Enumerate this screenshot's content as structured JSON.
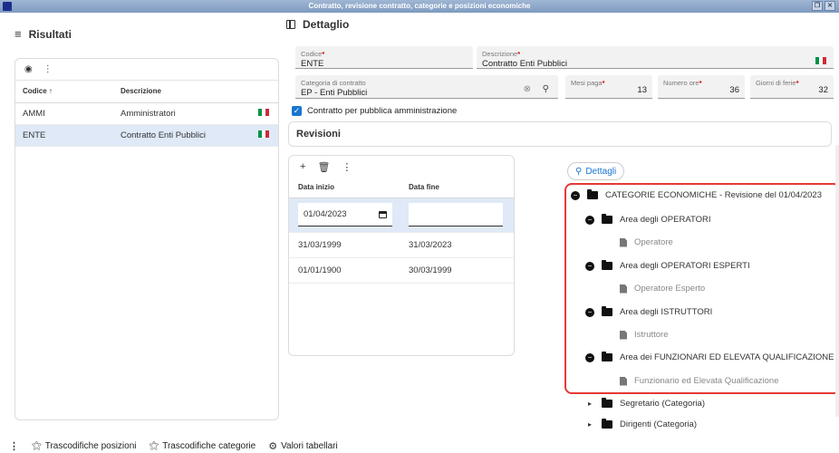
{
  "window": {
    "title": "Contratto, revisione contratto, categorie e posizioni economiche"
  },
  "left": {
    "title": "Risultati",
    "columns": [
      "Codice",
      "Descrizione"
    ],
    "sort_indicator": "↑",
    "rows": [
      {
        "codice": "AMMI",
        "descrizione": "Amministratori"
      },
      {
        "codice": "ENTE",
        "descrizione": "Contratto Enti Pubblici"
      }
    ]
  },
  "detail": {
    "title": "Dettaglio",
    "codice": {
      "label": "Codice",
      "value": "ENTE"
    },
    "descrizione": {
      "label": "Descrizione",
      "value": "Contratto Enti Pubblici"
    },
    "categoria": {
      "label": "Categoria di contratto",
      "value": "EP - Enti Pubblici"
    },
    "mesi_paga": {
      "label": "Mesi paga",
      "value": "13"
    },
    "numero_ore": {
      "label": "Numero ore",
      "value": "36"
    },
    "giorni_ferie": {
      "label": "Giorni di ferie",
      "value": "32"
    },
    "checkbox_label": "Contratto per pubblica amministrazione",
    "required_mark": "*"
  },
  "revisioni": {
    "title": "Revisioni",
    "columns": [
      "Data inizio",
      "Data fine"
    ],
    "editing_row": {
      "inizio": "01/04/2023",
      "fine": ""
    },
    "rows": [
      {
        "inizio": "31/03/1999",
        "fine": "31/03/2023"
      },
      {
        "inizio": "01/01/1900",
        "fine": "30/03/1999"
      }
    ]
  },
  "tree": {
    "dettagli_label": "Dettagli",
    "root": "CATEGORIE ECONOMICHE - Revisione del 01/04/2023",
    "areas": [
      {
        "name": "Area degli OPERATORI",
        "leaf": "Operatore"
      },
      {
        "name": "Area degli OPERATORI ESPERTI",
        "leaf": "Operatore Esperto"
      },
      {
        "name": "Area degli ISTRUTTORI",
        "leaf": "Istruttore"
      },
      {
        "name": "Area dei FUNZIONARI ED ELEVATA QUALIFICAZIONE",
        "leaf": "Funzionario ed Elevata Qualificazione"
      }
    ],
    "others": [
      "Segretario (Categoria)",
      "Dirigenti (Categoria)"
    ]
  },
  "bottom": {
    "buttons": [
      "Trascodifiche posizioni",
      "Trascodifiche categorie",
      "Valori tabellari"
    ]
  },
  "accent": "#1976d2",
  "highlight_color": "#e53935"
}
